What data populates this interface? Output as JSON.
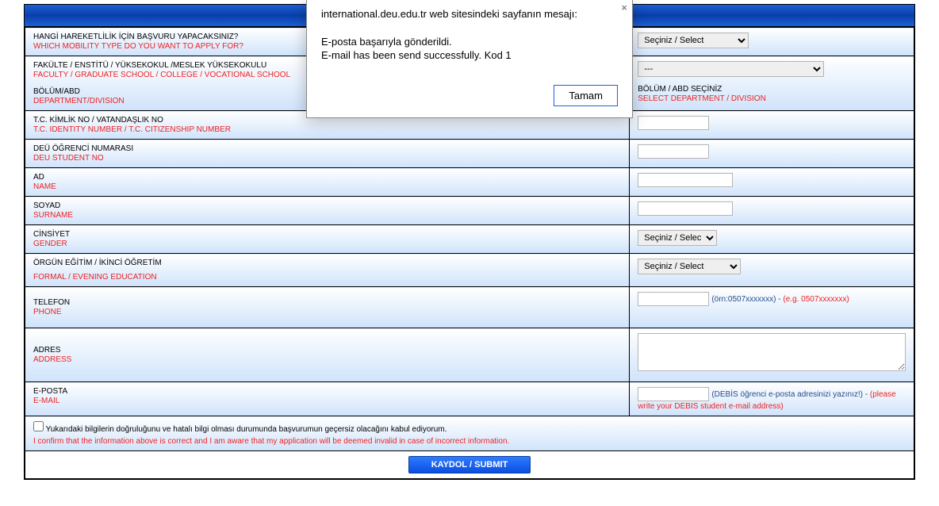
{
  "modal": {
    "title": "international.deu.edu.tr web sitesindeki sayfanın mesajı:",
    "line1": "E-posta başarıyla gönderildi.",
    "line2": "E-mail has been send successfully. Kod 1",
    "ok": "Tamam"
  },
  "rows": {
    "mobility": {
      "tr": "HANGİ HAREKETLİLİK İÇİN BAŞVURU YAPACAKSINIZ?",
      "en": "WHICH MOBILITY TYPE DO YOU WANT TO APPLY FOR?"
    },
    "faculty": {
      "tr": "FAKÜLTE / ENSTİTÜ / YÜKSEKOKUL /MESLEK YÜKSEKOKULU",
      "en": "FACULTY / GRADUATE SCHOOL / COLLEGE / VOCATIONAL SCHOOL"
    },
    "dept": {
      "tr": "BÖLÜM/ABD",
      "en": "DEPARTMENT/DIVISION"
    },
    "deptSelect": {
      "tr": "BÖLÜM / ABD SEÇİNİZ",
      "en": "SELECT DEPARTMENT / DIVISION"
    },
    "tc": {
      "tr": "T.C. KİMLİK NO / VATANDAŞLIK NO",
      "en": "T.C. IDENTITY NUMBER / T.C. CITIZENSHIP NUMBER"
    },
    "stuno": {
      "tr": "DEÜ ÖĞRENCİ NUMARASI",
      "en": "DEU STUDENT NO"
    },
    "name": {
      "tr": "AD",
      "en": "NAME"
    },
    "surname": {
      "tr": "SOYAD",
      "en": "SURNAME"
    },
    "gender": {
      "tr": "CİNSİYET",
      "en": "GENDER"
    },
    "edu": {
      "tr": "ÖRGÜN EĞİTİM / İKİNCİ ÖĞRETİM",
      "en": "FORMAL / EVENING EDUCATION"
    },
    "phone": {
      "tr": "TELEFON",
      "en": "PHONE"
    },
    "phoneHintTr": "(örn:0507xxxxxxx) - ",
    "phoneHintEn": "(e.g. 0507xxxxxxx)",
    "address": {
      "tr": "ADRES",
      "en": "ADDRESS"
    },
    "email": {
      "tr": "E-POSTA",
      "en": "E-MAIL"
    },
    "emailHintTr": "(DEBİS öğrenci e-posta adresinizi yazınız!) - ",
    "emailHintEn": "(please write your DEBIS student e-mail address)"
  },
  "selects": {
    "mobility": "Seçiniz / Select",
    "faculty": "---",
    "gender": "Seçiniz / Select",
    "edu": "Seçiniz / Select"
  },
  "confirm": {
    "tr": "Yukarıdaki bilgilerin doğruluğunu ve hatalı bilgi olması durumunda başvurumun geçersiz olacağını kabul ediyorum.",
    "en": "I confirm that the information above is correct and I am aware that my application will be deemed invalid in case of incorrect information."
  },
  "submit": "KAYDOL / SUBMIT"
}
